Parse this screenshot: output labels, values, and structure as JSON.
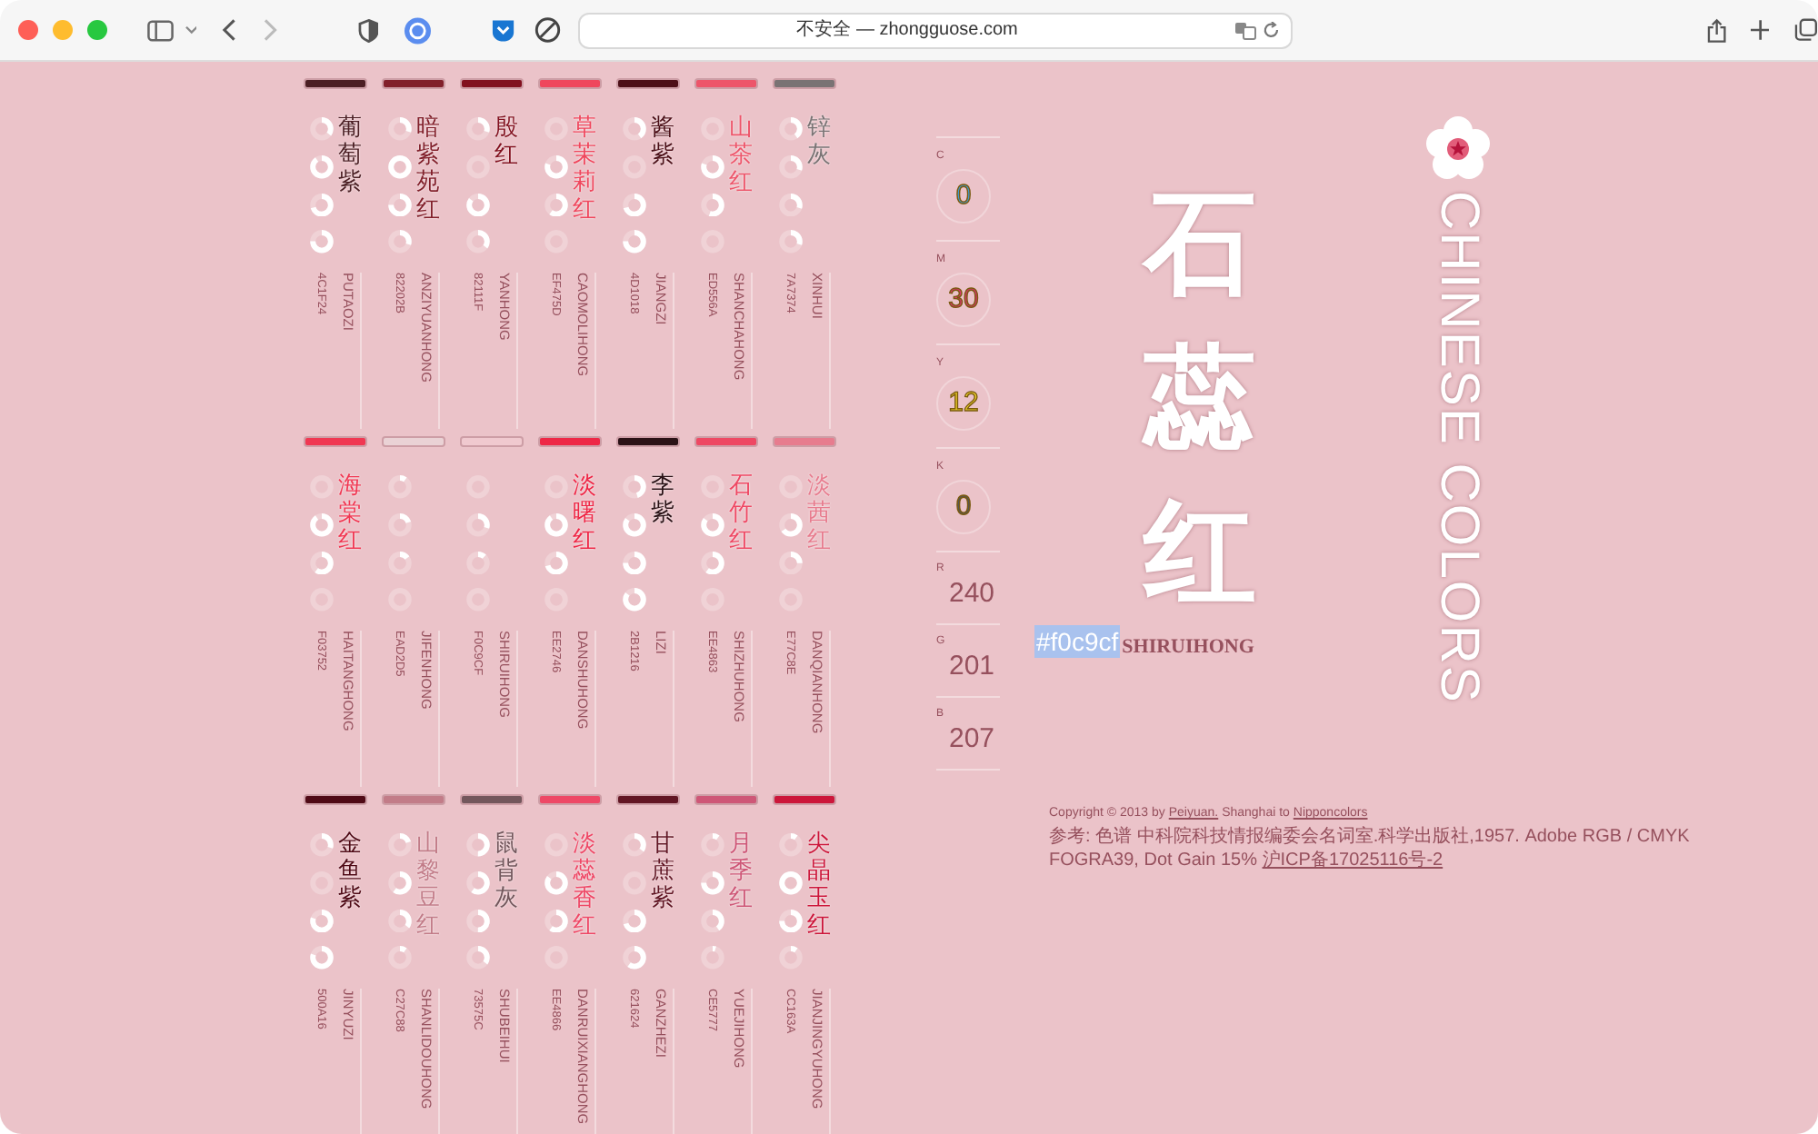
{
  "browser": {
    "address": "不安全 — zhongguose.com"
  },
  "colors": [
    {
      "name": "葡萄紫",
      "pinyin": "PUTAOZI",
      "hex": "4C1F24",
      "color": "#4c1f24",
      "gauges": [
        {
          "level": 0.35
        },
        {
          "level": 0.9
        },
        {
          "level": 0.7
        },
        {
          "level": 0.75
        }
      ]
    },
    {
      "name": "暗紫苑红",
      "pinyin": "ANZIYUANHONG",
      "hex": "82202B",
      "color": "#82202b",
      "gauges": [
        {
          "level": 0.3
        },
        {
          "level": 1
        },
        {
          "level": 0.75
        },
        {
          "level": 0.3
        }
      ]
    },
    {
      "name": "殷红",
      "pinyin": "YANHONG",
      "hex": "82111F",
      "color": "#82111f",
      "gauges": [
        {
          "level": 0.3
        },
        {
          "level": 0
        },
        {
          "level": 0.85
        },
        {
          "level": 0.35
        }
      ]
    },
    {
      "name": "草茉莉红",
      "pinyin": "CAOMOLIHONG",
      "hex": "EF475D",
      "color": "#ef475d",
      "gauges": [
        {
          "level": 0
        },
        {
          "level": 0.8
        },
        {
          "level": 0.6
        },
        {
          "level": 0
        }
      ]
    },
    {
      "name": "酱紫",
      "pinyin": "JIANGZI",
      "hex": "4D1018",
      "color": "#4d1018",
      "gauges": [
        {
          "level": 0.4
        },
        {
          "level": 0
        },
        {
          "level": 0.7
        },
        {
          "level": 0.75
        }
      ]
    },
    {
      "name": "山茶红",
      "pinyin": "SHANCHAHONG",
      "hex": "ED556A",
      "color": "#ed556a",
      "gauges": [
        {
          "level": 0
        },
        {
          "level": 0.8
        },
        {
          "level": 0.55
        },
        {
          "level": 0
        }
      ]
    },
    {
      "name": "锌灰",
      "pinyin": "XINHUI",
      "hex": "7A7374",
      "color": "#7a7374",
      "gauges": [
        {
          "level": 0.4
        },
        {
          "level": 0.3
        },
        {
          "level": 0.3
        },
        {
          "level": 0.3
        }
      ]
    },
    {
      "name": "海棠红",
      "pinyin": "HAITANGHONG",
      "hex": "F03752",
      "color": "#f03752",
      "gauges": [
        {
          "level": 0
        },
        {
          "level": 0.9
        },
        {
          "level": 0.6
        },
        {
          "level": 0
        }
      ]
    },
    {
      "pinyin": "JIFENHONG",
      "hex": "EAD2D5",
      "color": "#ead2d5",
      "gauges": [
        {
          "level": 0.1
        },
        {
          "level": 0.2
        },
        {
          "level": 0.15
        },
        {
          "level": 0
        }
      ]
    },
    {
      "pinyin": "SHIRUIHONG",
      "hex": "F0C9CF",
      "color": "#f0c9cf",
      "gauges": [
        {
          "level": 0
        },
        {
          "level": 0.3
        },
        {
          "level": 0.12
        },
        {
          "level": 0
        }
      ]
    },
    {
      "name": "淡曙红",
      "pinyin": "DANSHUHONG",
      "hex": "EE2746",
      "color": "#ee2746",
      "gauges": [
        {
          "level": 0
        },
        {
          "level": 0.9
        },
        {
          "level": 0.7
        },
        {
          "level": 0
        }
      ]
    },
    {
      "name": "李紫",
      "pinyin": "LIZI",
      "hex": "2B1216",
      "color": "#2b1216",
      "gauges": [
        {
          "level": 0.45
        },
        {
          "level": 0.85
        },
        {
          "level": 0.75
        },
        {
          "level": 0.85
        }
      ]
    },
    {
      "name": "石竹红",
      "pinyin": "SHIZHUHONG",
      "hex": "EE4863",
      "color": "#ee4863",
      "gauges": [
        {
          "level": 0
        },
        {
          "level": 0.85
        },
        {
          "level": 0.6
        },
        {
          "level": 0
        }
      ]
    },
    {
      "name": "淡茜红",
      "pinyin": "DANQIANHONG",
      "hex": "E77C8E",
      "color": "#e77c8e",
      "gauges": [
        {
          "level": 0
        },
        {
          "level": 0.65
        },
        {
          "level": 0.25
        },
        {
          "level": 0
        }
      ]
    },
    {
      "name": "金鱼紫",
      "pinyin": "JINYUZI",
      "hex": "500A16",
      "color": "#500a16",
      "gauges": [
        {
          "level": 0.3
        },
        {
          "level": 0
        },
        {
          "level": 0.8
        },
        {
          "level": 0.8
        }
      ]
    },
    {
      "name": "山黎豆红",
      "pinyin": "SHANLIDOUHONG",
      "hex": "C27C88",
      "color": "#c27c88",
      "gauges": [
        {
          "level": 0.2
        },
        {
          "level": 0.6
        },
        {
          "level": 0.35
        },
        {
          "level": 0.1
        }
      ]
    },
    {
      "name": "鼠背灰",
      "pinyin": "SHUBEIHUI",
      "hex": "73575C",
      "color": "#73575c",
      "gauges": [
        {
          "level": 0.5
        },
        {
          "level": 0.6
        },
        {
          "level": 0.5
        },
        {
          "level": 0.35
        }
      ]
    },
    {
      "name": "淡蕊香红",
      "pinyin": "DANRUIXIANGHONG",
      "hex": "EE4866",
      "color": "#ee4866",
      "gauges": [
        {
          "level": 0
        },
        {
          "level": 0.85
        },
        {
          "level": 0.6
        },
        {
          "level": 0
        }
      ]
    },
    {
      "name": "甘蔗紫",
      "pinyin": "GANZHEZI",
      "hex": "621624",
      "color": "#621624",
      "gauges": [
        {
          "level": 0.35
        },
        {
          "level": 0
        },
        {
          "level": 0.7
        },
        {
          "level": 0.6
        }
      ]
    },
    {
      "name": "月季红",
      "pinyin": "YUEJIHONG",
      "hex": "CE5777",
      "color": "#ce5777",
      "gauges": [
        {
          "level": 0.1
        },
        {
          "level": 0.75
        },
        {
          "level": 0.4
        },
        {
          "level": 0.05
        }
      ]
    },
    {
      "name": "尖晶玉红",
      "pinyin": "JIANJINGYUHONG",
      "hex": "CC163A",
      "color": "#cc163a",
      "gauges": [
        {
          "level": 0.1
        },
        {
          "level": 1
        },
        {
          "level": 0.75
        },
        {
          "level": 0.1
        }
      ]
    }
  ],
  "current": {
    "name": "石蕊红",
    "hex": "#f0c9cf",
    "pinyin": "SHIRUIHONG",
    "values": [
      {
        "kind": "cmyk",
        "label": "C",
        "value": "0",
        "color": "#3d9ad6"
      },
      {
        "kind": "cmyk",
        "label": "M",
        "value": "30",
        "color": "#d9336f"
      },
      {
        "kind": "cmyk",
        "label": "Y",
        "value": "12",
        "color": "#f3d42a"
      },
      {
        "kind": "cmyk",
        "label": "K",
        "value": "0",
        "color": "#555555"
      },
      {
        "kind": "rgb",
        "label": "R",
        "value": "240"
      },
      {
        "kind": "rgb",
        "label": "G",
        "value": "201"
      },
      {
        "kind": "rgb",
        "label": "B",
        "value": "207"
      }
    ]
  },
  "logo": {
    "title": "CHINESE COLORS"
  },
  "footer": [
    [
      {
        "kind": "text",
        "text": "Copyright © 2013 by "
      },
      {
        "kind": "link",
        "text": "Peiyuan."
      },
      {
        "kind": "text",
        "text": " Shanghai to "
      },
      {
        "kind": "link",
        "text": "Nipponcolors"
      }
    ],
    [
      {
        "kind": "text",
        "text": "参考: 色谱 中科院科技情报编委会名词室.科学出版社,1957. Adobe RGB / CMYK FOGRA39, Dot Gain 15% "
      },
      {
        "kind": "link",
        "text": "沪ICP备17025116号-2"
      }
    ]
  ]
}
